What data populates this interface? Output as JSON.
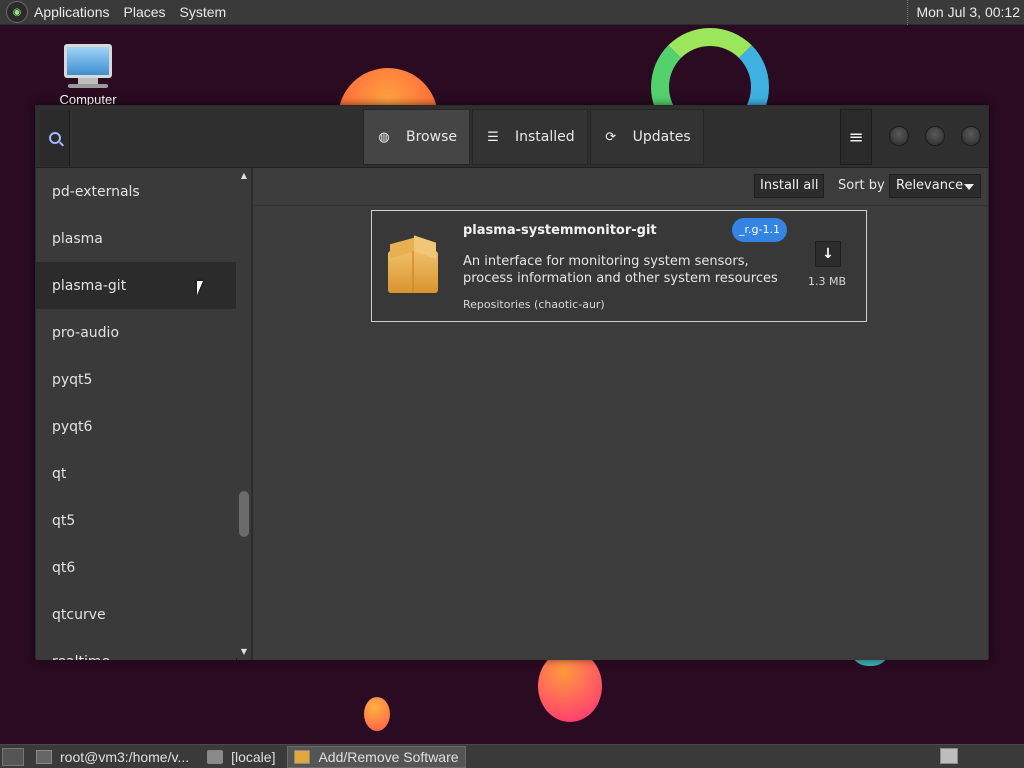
{
  "top_panel": {
    "menus": [
      "Applications",
      "Places",
      "System"
    ],
    "clock": "Mon Jul  3, 00:12"
  },
  "desktop": {
    "icon_label": "Computer"
  },
  "window": {
    "tabs": [
      {
        "label": "Browse",
        "icon": "globe-icon"
      },
      {
        "label": "Installed",
        "icon": "list-icon"
      },
      {
        "label": "Updates",
        "icon": "refresh-icon"
      }
    ],
    "sidebar_items": [
      "pd-externals",
      "plasma",
      "plasma-git",
      "pro-audio",
      "pyqt5",
      "pyqt6",
      "qt",
      "qt5",
      "qt6",
      "qtcurve",
      "realtime"
    ],
    "selected_item": "plasma-git",
    "toolbar": {
      "install_all_label": "Install all",
      "sort_label": "Sort by",
      "sort_value": "Relevance"
    },
    "package": {
      "name": "plasma-systemmonitor-git",
      "version": "_r.g-1.1",
      "description": "An interface for monitoring system sensors, process information and other system resources",
      "repository": "Repositories (chaotic-aur)",
      "size": "1.3 MB"
    }
  },
  "bottom_panel": {
    "tasks": [
      {
        "label": "root@vm3:/home/v...",
        "icon": "terminal-icon"
      },
      {
        "label": "[locale]",
        "icon": "folder-icon"
      },
      {
        "label": "Add/Remove Software",
        "icon": "package-icon",
        "active": true
      }
    ]
  },
  "colors": {
    "accent": "#3584e4",
    "window_bg": "#3b3b3b",
    "desktop_bg": "#2a0b22"
  }
}
